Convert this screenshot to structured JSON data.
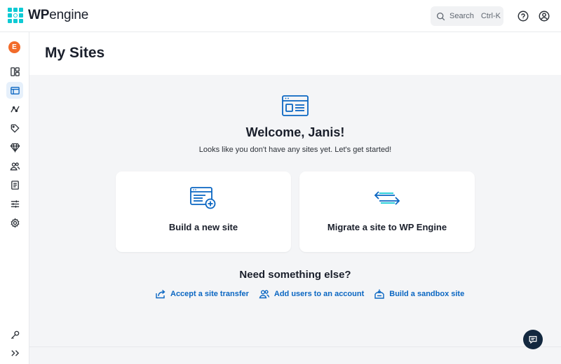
{
  "brand": {
    "logo_bold": "WP",
    "logo_rest": "engine",
    "accent": "#0ecad4"
  },
  "header": {
    "search_label": "Search",
    "search_shortcut": "Ctrl-K",
    "help_icon": "help-circle-icon",
    "account_icon": "user-circle-icon"
  },
  "sidebar": {
    "avatar_initial": "E",
    "avatar_color": "#f26b2a",
    "items": [
      {
        "icon": "dashboard-icon"
      },
      {
        "icon": "sites-icon",
        "active": true
      },
      {
        "icon": "analytics-icon"
      },
      {
        "icon": "tag-icon"
      },
      {
        "icon": "gem-icon"
      },
      {
        "icon": "users-icon"
      },
      {
        "icon": "billing-icon"
      },
      {
        "icon": "settings-sliders-icon"
      },
      {
        "icon": "gear-icon"
      }
    ],
    "bottom": [
      {
        "icon": "key-icon"
      },
      {
        "icon": "expand-icon"
      }
    ]
  },
  "page": {
    "title": "My Sites",
    "welcome": "Welcome, Janis!",
    "subtitle": "Looks like you don't have any sites yet. Let's get started!"
  },
  "cards": [
    {
      "label": "Build a new site",
      "icon": "build-site-icon"
    },
    {
      "label": "Migrate a site to WP Engine",
      "icon": "migrate-icon"
    }
  ],
  "more": {
    "heading": "Need something else?",
    "links": [
      {
        "label": "Accept a site transfer",
        "icon": "transfer-icon"
      },
      {
        "label": "Add users to an account",
        "icon": "add-users-icon"
      },
      {
        "label": "Build a sandbox site",
        "icon": "sandbox-icon"
      }
    ]
  },
  "chat": {
    "icon": "chat-icon"
  },
  "colors": {
    "link": "#0a66c2",
    "primary_icon": "#0a66c2",
    "background": "#f4f5f7"
  }
}
